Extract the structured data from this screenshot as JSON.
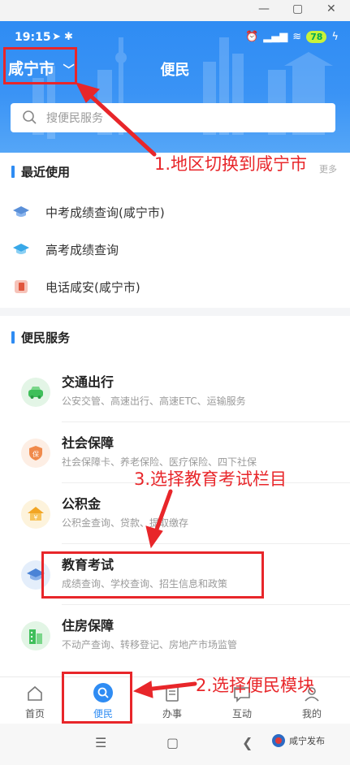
{
  "status": {
    "time": "19:15",
    "battery": "78"
  },
  "header": {
    "city": "咸宁市",
    "title": "便民"
  },
  "search": {
    "placeholder": "搜便民服务"
  },
  "recent": {
    "title": "最近使用",
    "more": "更多",
    "items": [
      {
        "label": "中考成绩查询(咸宁市)",
        "icon": "graduation-cap-icon"
      },
      {
        "label": "高考成绩查询",
        "icon": "graduation-cap-icon"
      },
      {
        "label": "电话咸安(咸宁市)",
        "icon": "phone-icon"
      }
    ]
  },
  "services": {
    "title": "便民服务",
    "items": [
      {
        "name": "交通出行",
        "desc": "公安交管、高速出行、高速ETC、运输服务",
        "icon": "car-icon"
      },
      {
        "name": "社会保障",
        "desc": "社会保障卡、养老保险、医疗保险、四下社保",
        "icon": "shield-icon"
      },
      {
        "name": "公积金",
        "desc": "公积金查询、贷款、提取缴存",
        "icon": "house-fund-icon"
      },
      {
        "name": "教育考试",
        "desc": "成绩查询、学校查询、招生信息和政策",
        "icon": "graduation-cap-icon"
      },
      {
        "name": "住房保障",
        "desc": "不动产查询、转移登记、房地产市场监管",
        "icon": "building-icon"
      }
    ]
  },
  "tabs": [
    {
      "label": "首页",
      "icon": "home-icon"
    },
    {
      "label": "便民",
      "icon": "search-icon",
      "active": true
    },
    {
      "label": "办事",
      "icon": "document-icon"
    },
    {
      "label": "互动",
      "icon": "chat-icon"
    },
    {
      "label": "我的",
      "icon": "user-icon"
    }
  ],
  "annotations": {
    "step1": "1.地区切换到咸宁市",
    "step2": "2.选择便民模块",
    "step3": "3.选择教育考试栏目"
  },
  "watermark": "咸宁发布",
  "colors": {
    "primary": "#2f8cf3",
    "annotation": "#e8262a"
  }
}
